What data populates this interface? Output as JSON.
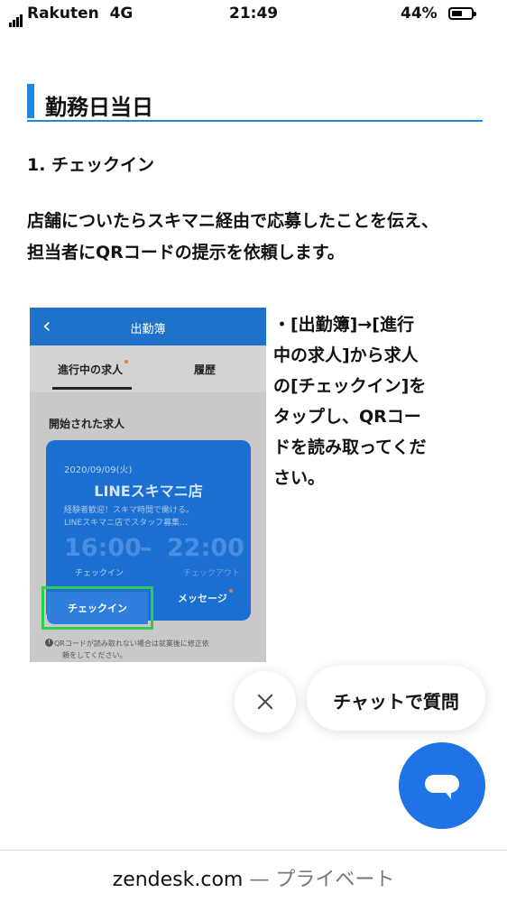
{
  "status_bar": {
    "carrier": "Rakuten",
    "network": "4G",
    "time": "21:49",
    "battery_percent": "44%",
    "battery_level": 0.44
  },
  "article": {
    "section_title": "勤務日当日",
    "step_title": "1. チェックイン",
    "paragraph_line1": "店舗についたらスキマニ経由で応募したことを伝え、",
    "paragraph_line2": "担当者にQRコードの提示を依頼します。",
    "instructions": [
      "・[出勤簿]→[進行",
      "中の求人]から求人",
      "の[チェックイン]を",
      "タップし、QRコー",
      "ドを読み取ってくだ",
      "さい。"
    ]
  },
  "embedded_screenshot": {
    "back_icon": "chevron-left-icon",
    "nav_title": "出勤簿",
    "tab_active": "進行中の求人",
    "tab_inactive": "履歴",
    "section_label": "開始された求人",
    "card": {
      "date": "2020/09/09(火)",
      "store_name": "LINEスキマニ店",
      "desc_line1": "経験者歓迎！スキマ時間で働ける。",
      "desc_line2": "LINEスキマニ店でスタッフ募集…",
      "start_time": "16:00",
      "dash": "–",
      "end_time": "22:00",
      "label_checkin": "チェックイン",
      "label_checkout": "チェックアウト",
      "checkin_button": "チェックイン",
      "message_button": "メッセージ"
    },
    "note_line1": "QRコードが読み取れない場合は就業後に修正依",
    "note_line2": "頼をしてください。",
    "accent_color": "#1a6fd0",
    "highlight_color": "#2ecc4f"
  },
  "chat_widget": {
    "close_icon": "close-icon",
    "prompt_label": "チャットで質問",
    "launcher_icon": "chat-bubble-icon",
    "brand_color": "#1f73e6"
  },
  "footer": {
    "domain": "zendesk.com",
    "rest": " — プライベート"
  }
}
